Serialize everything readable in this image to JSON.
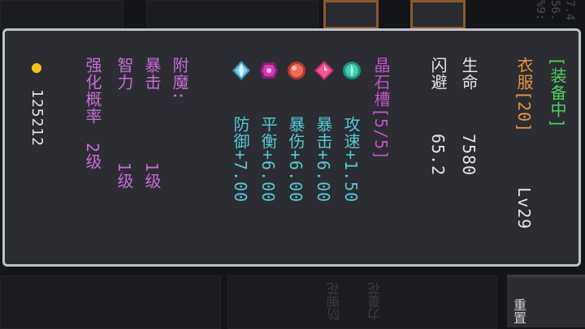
{
  "background": {
    "corner_stats": [
      "7.4",
      "56.",
      "%9:"
    ],
    "bottom_labels": [
      "防御花",
      "力量花"
    ],
    "side_button_label": "重置"
  },
  "item": {
    "equip_status": "[装备中]",
    "name": "衣服[20]",
    "level": "Lv29",
    "stats": [
      {
        "label": "生命",
        "value": "7580"
      },
      {
        "label": "闪避",
        "value": "65.2"
      }
    ],
    "gem_slots_label": "晶石槽[5/5]",
    "gems": [
      {
        "icon": "diamond-gem-icon",
        "color": "#7ad6f0"
      },
      {
        "icon": "amethyst-gem-icon",
        "color": "#d03fb0"
      },
      {
        "icon": "ruby-gem-icon",
        "color": "#f06a5a"
      },
      {
        "icon": "pink-gem-icon",
        "color": "#f05a92"
      },
      {
        "icon": "emerald-gem-icon",
        "color": "#3bd2b0"
      }
    ],
    "gem_bonuses": [
      "攻速+1.50",
      "暴击+6.00",
      "暴伤+6.00",
      "平衡+6.00",
      "防御+7.00"
    ],
    "enchant_label": "附魔:",
    "enchants": [
      {
        "name": "暴击",
        "level": "1级"
      },
      {
        "name": "智力",
        "level": "1级"
      },
      {
        "name": "强化概率",
        "level": "2级"
      }
    ],
    "price_icon": "gold-coin-icon",
    "price": "125212"
  }
}
